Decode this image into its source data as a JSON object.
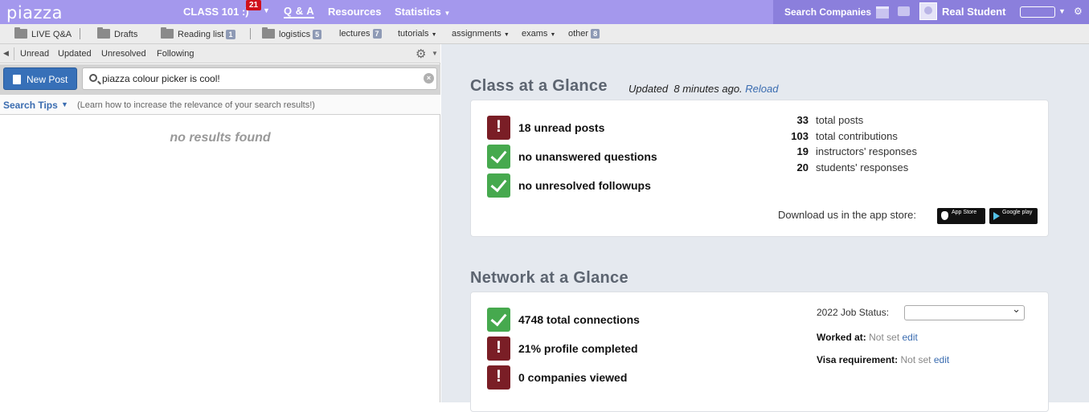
{
  "topbar": {
    "logo": "piazza",
    "class_name": "CLASS 101 :)",
    "class_badge": "21",
    "nav": {
      "qa": "Q & A",
      "resources": "Resources",
      "statistics": "Statistics"
    },
    "search_companies": "Search Companies",
    "user_name": "Real Student"
  },
  "folders": {
    "items": [
      {
        "label": "LIVE Q&A"
      },
      {
        "label": "Drafts"
      },
      {
        "label": "Reading list",
        "count": "1"
      },
      {
        "label": "logistics",
        "count": "5"
      },
      {
        "label": "lectures",
        "count": "7"
      },
      {
        "label": "tutorials"
      },
      {
        "label": "assignments"
      },
      {
        "label": "exams"
      },
      {
        "label": "other",
        "count": "8"
      }
    ]
  },
  "filters": {
    "unread": "Unread",
    "updated": "Updated",
    "unresolved": "Unresolved",
    "following": "Following"
  },
  "search": {
    "new_post": "New Post",
    "query": "piazza colour picker is cool!",
    "tips_label": "Search Tips",
    "tips_desc": "(Learn how to increase the relevance of your search results!)",
    "no_results": "no results found"
  },
  "class_glance": {
    "title": "Class at a Glance",
    "updated_label": "Updated",
    "updated_time": "8 minutes ago.",
    "reload": "Reload",
    "stats": [
      {
        "status": "bad",
        "text": "18 unread posts"
      },
      {
        "status": "good",
        "text": "no unanswered questions"
      },
      {
        "status": "good",
        "text": "no unresolved followups"
      }
    ],
    "counts": [
      {
        "value": "33",
        "label": "total posts"
      },
      {
        "value": "103",
        "label": "total contributions"
      },
      {
        "value": "19",
        "label": "instructors' responses"
      },
      {
        "value": "20",
        "label": "students' responses"
      }
    ],
    "download_label": "Download us in the app store:",
    "app_store": "App Store",
    "google_play": "Google play"
  },
  "network_glance": {
    "title": "Network at a Glance",
    "stats": [
      {
        "status": "good",
        "text": "4748 total connections"
      },
      {
        "status": "bad",
        "text": "21% profile completed"
      },
      {
        "status": "bad",
        "text": "0 companies viewed"
      }
    ],
    "job_status_label": "2022 Job Status:",
    "worked_at_label": "Worked at:",
    "worked_at_value": "Not set",
    "visa_label": "Visa requirement:",
    "visa_value": "Not set",
    "edit": "edit"
  }
}
